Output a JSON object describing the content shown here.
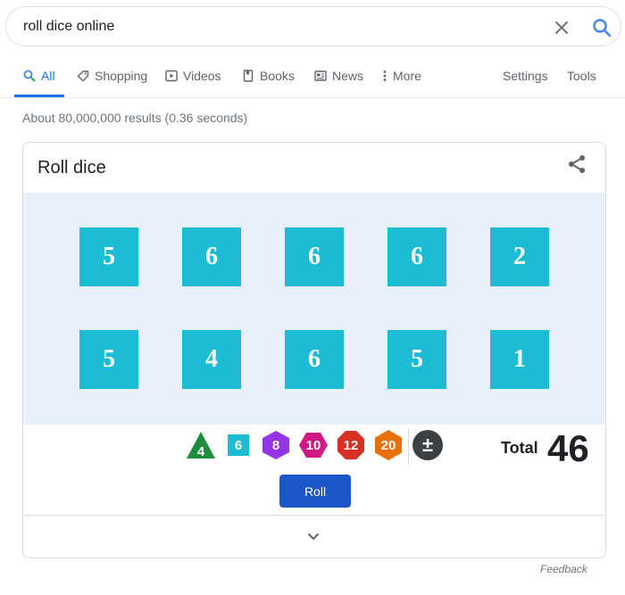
{
  "search": {
    "query": "roll dice online"
  },
  "tabs": [
    {
      "label": "All",
      "icon": "search-icon"
    },
    {
      "label": "Shopping",
      "icon": "tag-icon"
    },
    {
      "label": "Videos",
      "icon": "play-icon"
    },
    {
      "label": "Books",
      "icon": "book-icon"
    },
    {
      "label": "News",
      "icon": "newspaper-icon"
    },
    {
      "label": "More",
      "icon": "more-vert-icon"
    },
    {
      "label": "Settings"
    },
    {
      "label": "Tools"
    }
  ],
  "result_stats": "About 80,000,000 results (0.36 seconds)",
  "card": {
    "title": "Roll dice",
    "dice": [
      "5",
      "6",
      "6",
      "6",
      "2",
      "5",
      "4",
      "6",
      "5",
      "1"
    ],
    "total_label": "Total",
    "total_value": "46",
    "picker": [
      {
        "label": "4",
        "color": "#1e8e3e",
        "shape": "triangle"
      },
      {
        "label": "6",
        "color": "#1cbcd4",
        "shape": "square"
      },
      {
        "label": "8",
        "color": "#9334e6",
        "shape": "hexagon"
      },
      {
        "label": "10",
        "color": "#d01884",
        "shape": "hexagon"
      },
      {
        "label": "12",
        "color": "#d93025",
        "shape": "octagon"
      },
      {
        "label": "20",
        "color": "#e8710a",
        "shape": "hexagon"
      },
      {
        "label": "±",
        "color": "#3c4043",
        "shape": "circle"
      }
    ],
    "roll_label": "Roll"
  },
  "feedback": "Feedback",
  "colors": {
    "accent": "#1a73e8",
    "die": "#1cbcd4",
    "dice_area": "#e8f0fc",
    "roll_button": "#1a56c8"
  }
}
